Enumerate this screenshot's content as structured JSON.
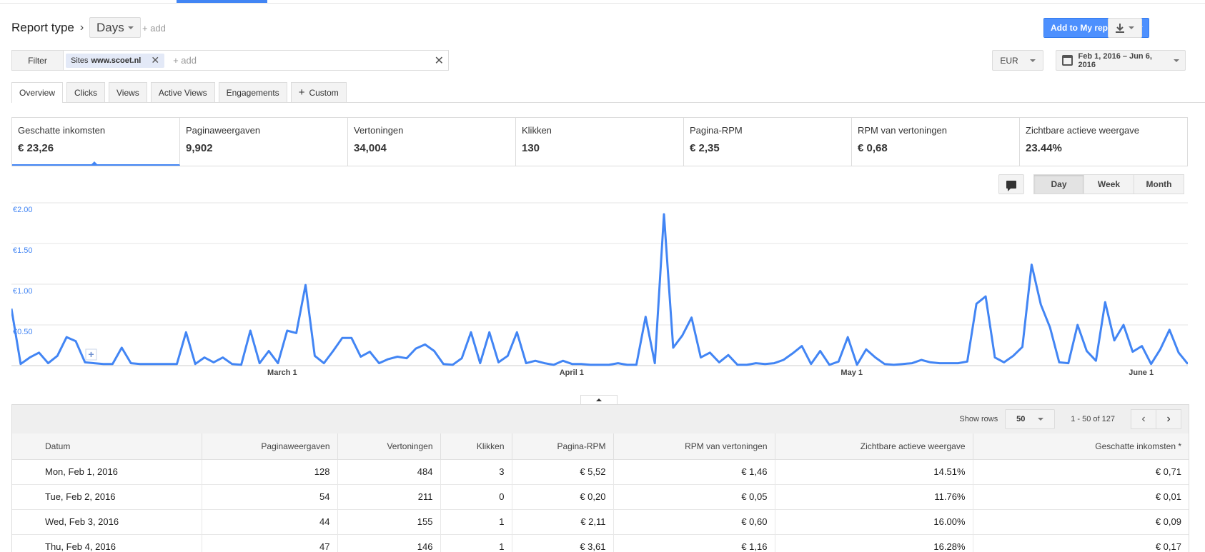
{
  "report": {
    "label": "Report type",
    "type_value": "Days",
    "add": "+ add",
    "add_reports": "Add to My reports"
  },
  "filter": {
    "button": "Filter",
    "chip_key": "Sites",
    "chip_value": "www.scoet.nl",
    "add": "+ add"
  },
  "currency": "EUR",
  "date_range": "Feb 1, 2016 – Jun 6, 2016",
  "tabs": [
    "Overview",
    "Clicks",
    "Views",
    "Active Views",
    "Engagements",
    "Custom"
  ],
  "metrics": [
    {
      "name": "Geschatte inkomsten",
      "value": "€ 23,26"
    },
    {
      "name": "Paginaweergaven",
      "value": "9,902"
    },
    {
      "name": "Vertoningen",
      "value": "34,004"
    },
    {
      "name": "Klikken",
      "value": "130"
    },
    {
      "name": "Pagina-RPM",
      "value": "€ 2,35"
    },
    {
      "name": "RPM van vertoningen",
      "value": "€ 0,68"
    },
    {
      "name": "Zichtbare actieve weergave",
      "value": "23.44%"
    }
  ],
  "granularity": [
    "Day",
    "Week",
    "Month"
  ],
  "colors": {
    "accent": "#4285f4",
    "primary_button": "#4d90fe",
    "line": "#4285f4"
  },
  "icons": [
    "chevron-right-icon",
    "dropdown-caret-icon",
    "download-icon",
    "close-icon",
    "calendar-icon",
    "plus-icon",
    "comment-icon",
    "chevron-left-icon"
  ],
  "chart_data": {
    "type": "line",
    "title": "",
    "series": [
      {
        "values": [
          0.7,
          0.02,
          0.1,
          0.16,
          0.03,
          0.12,
          0.35,
          0.3,
          0.04,
          0.03,
          0.02,
          0.02,
          0.22,
          0.03,
          0.02,
          0.02,
          0.02,
          0.02,
          0.02,
          0.41,
          0.02,
          0.1,
          0.04,
          0.1,
          0.02,
          0.01,
          0.43,
          0.03,
          0.18,
          0.03,
          0.43,
          0.4,
          0.99,
          0.12,
          0.03,
          0.18,
          0.34,
          0.34,
          0.11,
          0.17,
          0.03,
          0.08,
          0.11,
          0.09,
          0.21,
          0.26,
          0.18,
          0.02,
          0.01,
          0.09,
          0.41,
          0.03,
          0.41,
          0.04,
          0.12,
          0.41,
          0.03,
          0.06,
          0.03,
          0.01,
          0.06,
          0.02,
          0.02,
          0.01,
          0.01,
          0.01,
          0.03,
          0.01,
          0.01,
          0.6,
          0.03,
          1.86,
          0.22,
          0.37,
          0.59,
          0.1,
          0.16,
          0.04,
          0.13,
          0.01,
          0.01,
          0.03,
          0.02,
          0.03,
          0.07,
          0.15,
          0.24,
          0.02,
          0.18,
          0.01,
          0.05,
          0.35,
          0.01,
          0.2,
          0.1,
          0.02,
          0.01,
          0.02,
          0.03,
          0.07,
          0.04,
          0.03,
          0.03,
          0.03,
          0.05,
          0.76,
          0.85,
          0.1,
          0.04,
          0.12,
          0.23,
          1.24,
          0.75,
          0.47,
          0.04,
          0.03,
          0.5,
          0.18,
          0.06,
          0.78,
          0.31,
          0.5,
          0.17,
          0.24,
          0.02,
          0.2,
          0.44,
          0.16,
          0.02
        ],
        "color": "#4285f4"
      }
    ],
    "x_start": "2016-02-01",
    "x_end": "2016-06-06",
    "x_tick_labels": [
      "March 1",
      "April 1",
      "May 1",
      "June 1"
    ],
    "y_tick_labels": [
      "€0.50",
      "€1.00",
      "€1.50",
      "€2.00"
    ],
    "ylim": [
      0,
      2.0
    ],
    "grid": true
  },
  "table": {
    "show_rows_label": "Show rows",
    "rows_value": "50",
    "pager_text": "1 - 50 of 127",
    "headers": [
      "Datum",
      "Paginaweergaven",
      "Vertoningen",
      "Klikken",
      "Pagina-RPM",
      "RPM van vertoningen",
      "Zichtbare actieve weergave",
      "Geschatte inkomsten *"
    ],
    "rows": [
      [
        "Mon, Feb 1, 2016",
        "128",
        "484",
        "3",
        "€ 5,52",
        "€ 1,46",
        "14.51%",
        "€ 0,71"
      ],
      [
        "Tue, Feb 2, 2016",
        "54",
        "211",
        "0",
        "€ 0,20",
        "€ 0,05",
        "11.76%",
        "€ 0,01"
      ],
      [
        "Wed, Feb 3, 2016",
        "44",
        "155",
        "1",
        "€ 2,11",
        "€ 0,60",
        "16.00%",
        "€ 0,09"
      ],
      [
        "Thu, Feb 4, 2016",
        "47",
        "146",
        "1",
        "€ 3,61",
        "€ 1,16",
        "16.28%",
        "€ 0,17"
      ]
    ]
  }
}
